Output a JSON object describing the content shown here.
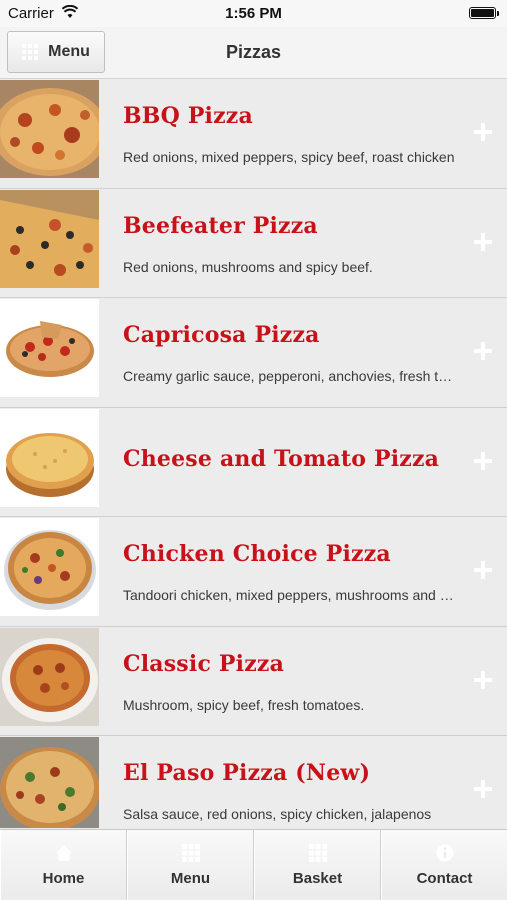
{
  "status_bar": {
    "carrier": "Carrier",
    "time": "1:56 PM"
  },
  "header": {
    "menu_label": "Menu",
    "title": "Pizzas"
  },
  "pizzas": [
    {
      "name": "BBQ Pizza",
      "description": "Red onions, mixed peppers, spicy beef, roast chicken"
    },
    {
      "name": "Beefeater Pizza",
      "description": "Red onions, mushrooms and spicy beef."
    },
    {
      "name": "Capricosa Pizza",
      "description": "Creamy garlic sauce, pepperoni, anchovies, fresh tomatoes"
    },
    {
      "name": "Cheese and Tomato Pizza",
      "description": ""
    },
    {
      "name": "Chicken Choice Pizza",
      "description": "Tandoori chicken, mixed peppers, mushrooms and onions"
    },
    {
      "name": "Classic Pizza",
      "description": "Mushroom, spicy beef, fresh tomatoes."
    },
    {
      "name": "El Paso Pizza (New)",
      "description": "Salsa sauce, red onions, spicy chicken, jalapenos"
    }
  ],
  "tabs": [
    {
      "label": "Home",
      "icon": "home-icon"
    },
    {
      "label": "Menu",
      "icon": "grid-icon"
    },
    {
      "label": "Basket",
      "icon": "grid-icon"
    },
    {
      "label": "Contact",
      "icon": "info-icon"
    }
  ],
  "colors": {
    "title_red": "#c8121a",
    "background": "#ececec"
  }
}
